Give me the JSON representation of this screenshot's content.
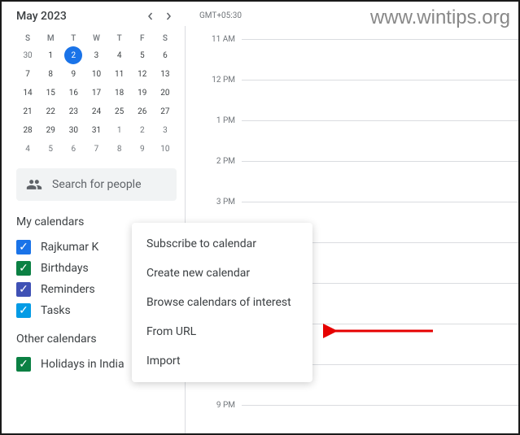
{
  "watermark": "www.wintips.org",
  "calendar": {
    "month": "May 2023",
    "dow": [
      "S",
      "M",
      "T",
      "W",
      "T",
      "F",
      "S"
    ],
    "weeks": [
      [
        {
          "d": "30",
          "muted": true
        },
        {
          "d": "1"
        },
        {
          "d": "2",
          "selected": true
        },
        {
          "d": "3"
        },
        {
          "d": "4"
        },
        {
          "d": "5"
        },
        {
          "d": "6"
        }
      ],
      [
        {
          "d": "7"
        },
        {
          "d": "8"
        },
        {
          "d": "9"
        },
        {
          "d": "10"
        },
        {
          "d": "11"
        },
        {
          "d": "12"
        },
        {
          "d": "13"
        }
      ],
      [
        {
          "d": "14"
        },
        {
          "d": "15"
        },
        {
          "d": "16"
        },
        {
          "d": "17"
        },
        {
          "d": "18"
        },
        {
          "d": "19"
        },
        {
          "d": "20"
        }
      ],
      [
        {
          "d": "21"
        },
        {
          "d": "22"
        },
        {
          "d": "23"
        },
        {
          "d": "24"
        },
        {
          "d": "25"
        },
        {
          "d": "26"
        },
        {
          "d": "27"
        }
      ],
      [
        {
          "d": "28"
        },
        {
          "d": "29"
        },
        {
          "d": "30"
        },
        {
          "d": "31"
        },
        {
          "d": "1",
          "muted": true
        },
        {
          "d": "2",
          "muted": true
        },
        {
          "d": "3",
          "muted": true
        }
      ],
      [
        {
          "d": "4",
          "muted": true
        },
        {
          "d": "5",
          "muted": true
        },
        {
          "d": "6",
          "muted": true
        },
        {
          "d": "7",
          "muted": true
        },
        {
          "d": "8",
          "muted": true
        },
        {
          "d": "9",
          "muted": true
        },
        {
          "d": "10",
          "muted": true
        }
      ]
    ]
  },
  "search": {
    "placeholder": "Search for people"
  },
  "sections": {
    "my_title": "My calendars",
    "other_title": "Other calendars"
  },
  "my_calendars": [
    {
      "label": "Rajkumar K",
      "color": "#1a73e8"
    },
    {
      "label": "Birthdays",
      "color": "#0b8043"
    },
    {
      "label": "Reminders",
      "color": "#3f51b5"
    },
    {
      "label": "Tasks",
      "color": "#039be5"
    }
  ],
  "other_calendars": [
    {
      "label": "Holidays in India",
      "color": "#0b8043"
    }
  ],
  "timezone": "GMT+05:30",
  "hours": [
    "11 AM",
    "12 PM",
    "1 PM",
    "2 PM",
    "3 PM",
    "",
    "",
    "",
    "",
    "9 PM"
  ],
  "menu": {
    "items": [
      "Subscribe to calendar",
      "Create new calendar",
      "Browse calendars of interest",
      "From URL",
      "Import"
    ]
  }
}
